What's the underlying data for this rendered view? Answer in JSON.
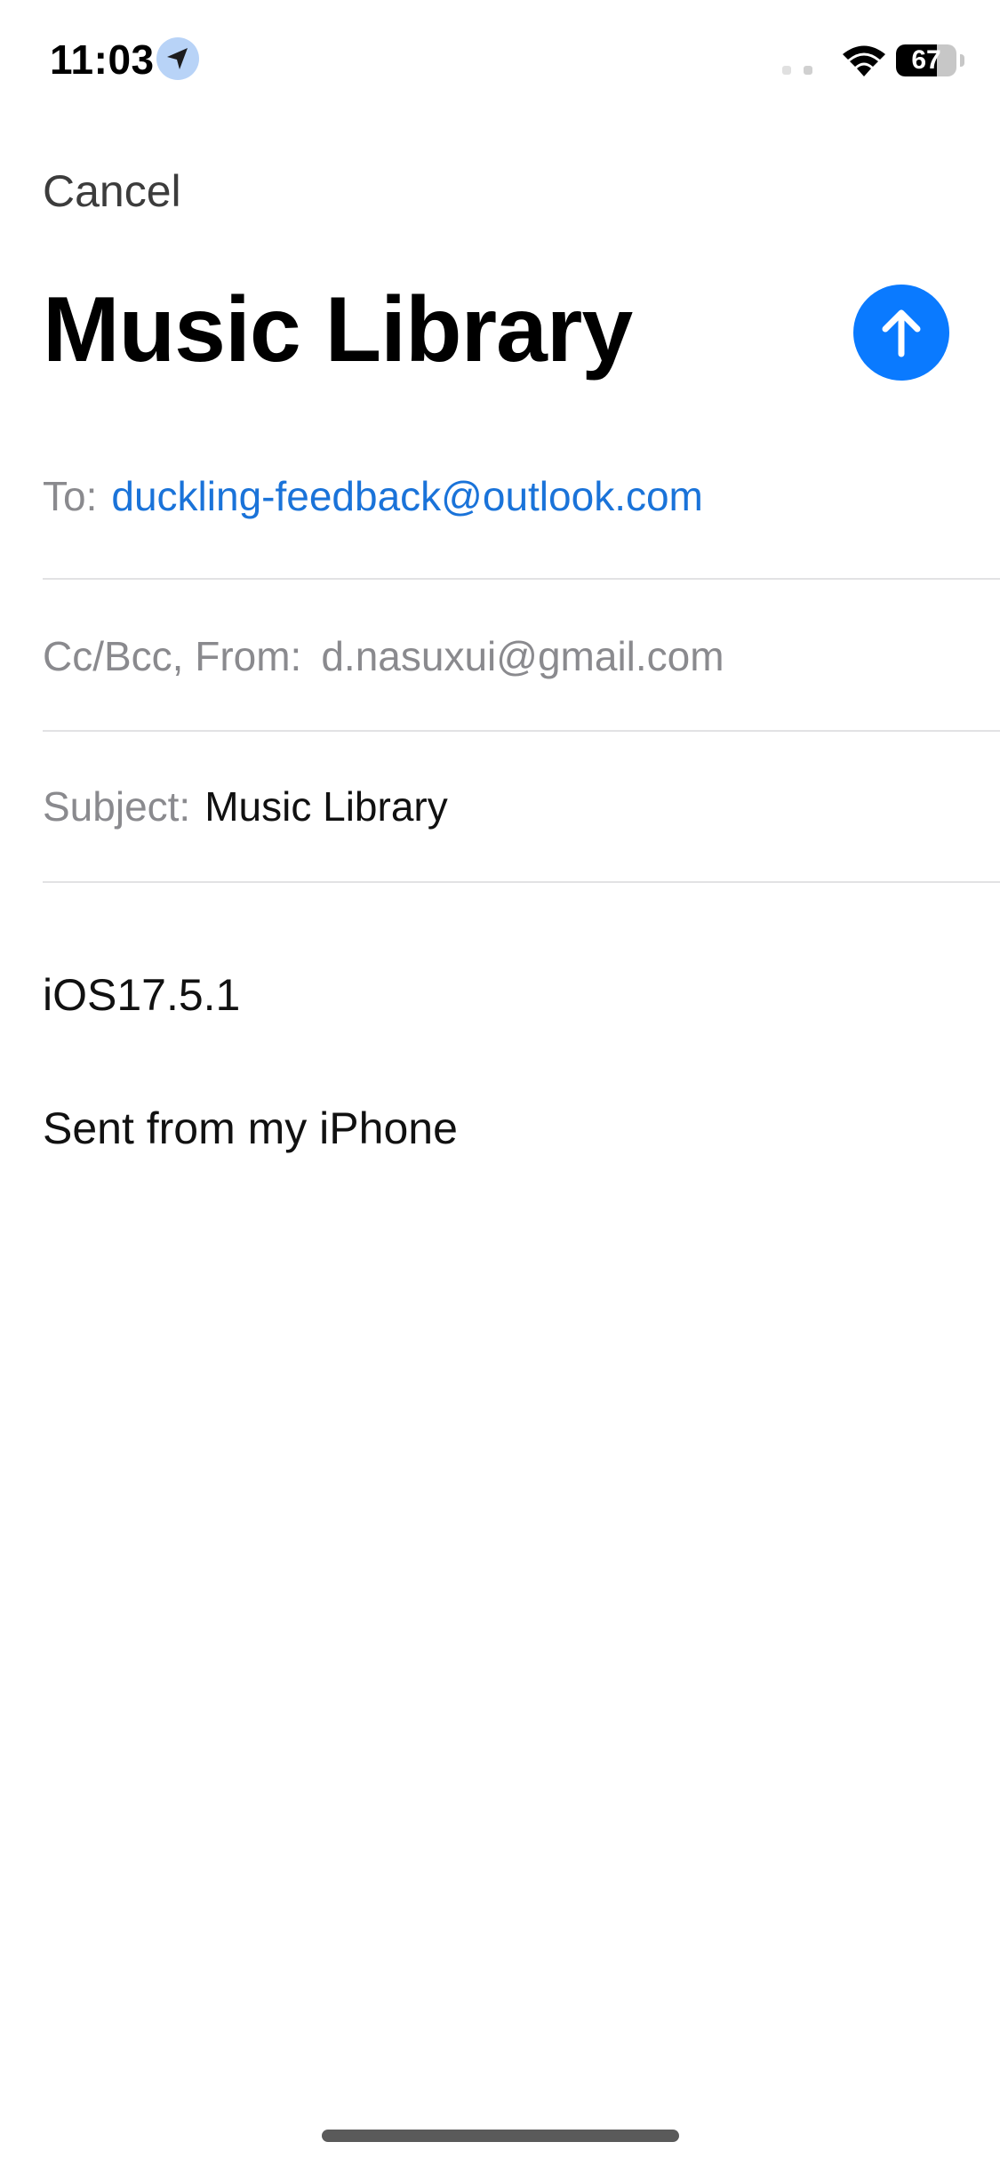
{
  "status_bar": {
    "time": "11:03",
    "battery_level": "67",
    "battery_percent": 67,
    "icons": [
      "location-arrow-icon",
      "signal-icon",
      "wifi-icon",
      "battery-icon"
    ]
  },
  "compose": {
    "cancel_label": "Cancel",
    "title": "Music Library",
    "send_icon": "arrow-up-icon",
    "accent_color": "#0a7aff"
  },
  "fields": {
    "to_label": "To:",
    "to_value": "duckling-feedback@outlook.com",
    "cc_label": "Cc/Bcc, From:",
    "cc_value": "d.nasuxui@gmail.com",
    "subject_label": "Subject:",
    "subject_value": "Music Library"
  },
  "body": {
    "line1": "iOS17.5.1",
    "signature": "Sent from my iPhone"
  }
}
